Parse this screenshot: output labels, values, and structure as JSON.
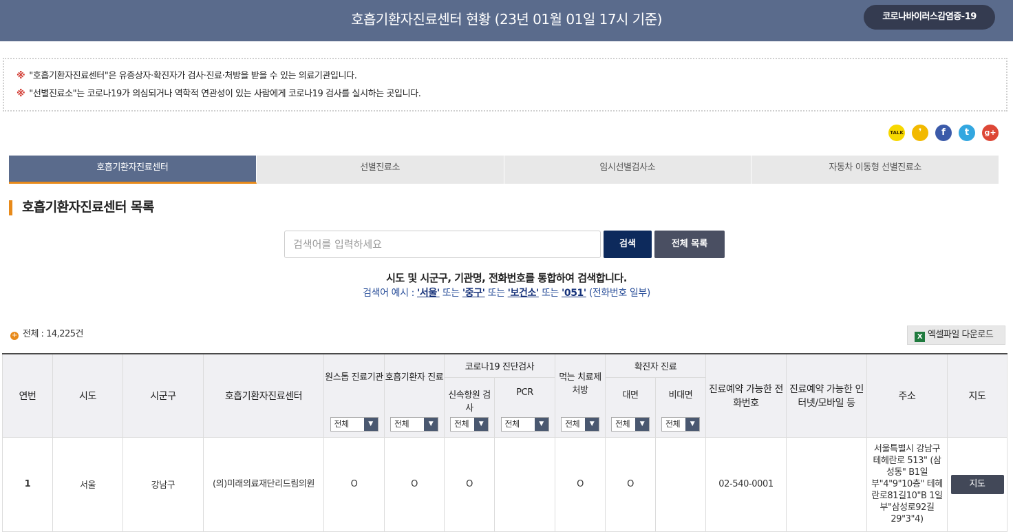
{
  "header": {
    "title": "호흡기환자진료센터 현황 (23년 01월 01일 17시 기준)",
    "corona_button": "코로나바이러스감염증-19"
  },
  "notice": {
    "mark": "※",
    "line1": "\"호흡기환자진료센터\"은 유증상자·확진자가 검사·진료·처방을 받을 수 있는 의료기관입니다.",
    "line2": "\"선별진료소\"는 코로나19가 의심되거나 역학적 연관성이 있는 사람에게 코로나19 검사를 실시하는 곳입니다."
  },
  "social": {
    "kakaotalk": "TALK",
    "kakaostory": "❜",
    "facebook": "f",
    "twitter": "t",
    "googleplus": "g+"
  },
  "tabs": [
    {
      "label": "호흡기환자진료센터"
    },
    {
      "label": "선별진료소"
    },
    {
      "label": "임시선별검사소"
    },
    {
      "label": "자동차 이동형 선별진료소"
    }
  ],
  "section_title": "호흡기환자진료센터 목록",
  "search": {
    "placeholder": "검색어를 입력하세요",
    "search_button": "검색",
    "all_button": "전체 목록",
    "help": "시도 및 시군구, 기관명, 전화번호를 통합하여 검색합니다.",
    "examples_prefix": "검색어 예시 :",
    "ex1": "'서울'",
    "or1": "또는",
    "ex2": "'중구'",
    "or2": "또는",
    "ex3": "'보건소'",
    "or3": "또는",
    "ex4": "'051'",
    "suffix": "(전화번호 일부)"
  },
  "total": {
    "icon": "+",
    "text": "전체 : 14,225건"
  },
  "excel": {
    "icon": "X",
    "label": "엑셀파일 다운로드"
  },
  "table": {
    "headers": {
      "no": "연번",
      "sido": "시도",
      "sigungu": "시군구",
      "center": "호흡기환자진료센터",
      "onestop": "원스톱 진료기관",
      "resp": "호흡기환자 진료",
      "diag_group": "코로나19 진단검사",
      "rapid": "신속항원 검사",
      "pcr": "PCR",
      "oral": "먹는 치료제 처방",
      "confirmed_group": "확진자 진료",
      "face": "대면",
      "nonface": "비대면",
      "phone": "진료예약 가능한 전화번호",
      "internet": "진료예약 가능한 인터넷/모바일 등",
      "address": "주소",
      "map": "지도"
    },
    "filter_value": "전체",
    "filter_arrow": "▼",
    "rows": [
      {
        "no": "1",
        "sido": "서울",
        "sigungu": "강남구",
        "center": "(의)미래의료재단리드림의원",
        "onestop": "O",
        "resp": "O",
        "rapid": "O",
        "pcr": "",
        "oral": "O",
        "face": "O",
        "nonface": "",
        "phone": "02-540-0001",
        "internet": "",
        "address": "서울특별시 강남구 테헤란로 513\" (삼성동\" B1일부\"4\"9\"10층\" 테헤란로81길10\"B 1일부\"삼성로92길 29\"3\"4)",
        "map": "지도"
      }
    ]
  }
}
